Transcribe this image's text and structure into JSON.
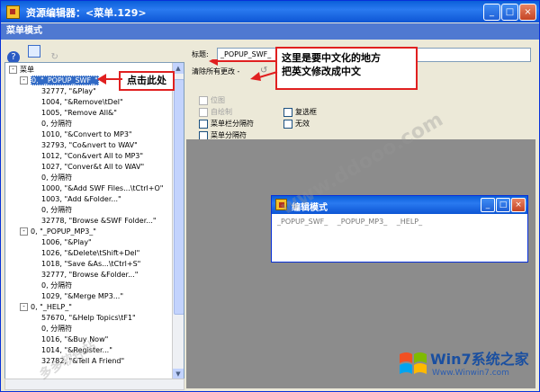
{
  "window": {
    "title": "资源编辑器：<菜单.129>",
    "min": "_",
    "max": "□",
    "close": "×"
  },
  "mode_bar": "菜单模式",
  "toolbar": {
    "help": "?",
    "image": "▣",
    "disabled": "↻"
  },
  "tree": {
    "root": "菜单",
    "rows": [
      {
        "text": "0, \"_POPUP_SWF_\"",
        "level": 1,
        "expand": "-",
        "selected": true
      },
      {
        "text": "32777, \"&Play\"",
        "level": 2
      },
      {
        "text": "1004, \"&Remove\\tDel\"",
        "level": 2
      },
      {
        "text": "1005, \"Remove All&\"",
        "level": 2
      },
      {
        "text": "0, 分隔符",
        "level": 2
      },
      {
        "text": "1010, \"&Convert to MP3\"",
        "level": 2
      },
      {
        "text": "32793, \"Co&nvert to WAV\"",
        "level": 2
      },
      {
        "text": "1012, \"Con&vert All to MP3\"",
        "level": 2
      },
      {
        "text": "1027, \"Conver&t All to WAV\"",
        "level": 2
      },
      {
        "text": "0, 分隔符",
        "level": 2
      },
      {
        "text": "1000, \"&Add SWF Files...\\tCtrl+O\"",
        "level": 2
      },
      {
        "text": "1003, \"Add &Folder...\"",
        "level": 2
      },
      {
        "text": "0, 分隔符",
        "level": 2
      },
      {
        "text": "32778, \"Browse &SWF Folder...\"",
        "level": 2
      },
      {
        "text": "0, \"_POPUP_MP3_\"",
        "level": 1,
        "expand": "-"
      },
      {
        "text": "1006, \"&Play\"",
        "level": 2
      },
      {
        "text": "1026, \"&Delete\\tShift+Del\"",
        "level": 2
      },
      {
        "text": "1018, \"Save &As...\\tCtrl+S\"",
        "level": 2
      },
      {
        "text": "32777, \"Browse &Folder...\"",
        "level": 2
      },
      {
        "text": "0, 分隔符",
        "level": 2
      },
      {
        "text": "1029, \"&Merge MP3...\"",
        "level": 2
      },
      {
        "text": "0, \"_HELP_\"",
        "level": 1,
        "expand": "-"
      },
      {
        "text": "57670, \"&Help Topics\\tF1\"",
        "level": 2
      },
      {
        "text": "0, 分隔符",
        "level": 2
      },
      {
        "text": "1016, \"&Buy Now\"",
        "level": 2
      },
      {
        "text": "1014, \"&Register...\"",
        "level": 2
      },
      {
        "text": "32782, \"&Tell A Friend\"",
        "level": 2
      }
    ]
  },
  "props": {
    "title_label": "标题:",
    "title_value": "_POPUP_SWF_",
    "clear_label": "清除所有更改 -",
    "checkboxes_left": [
      "位图",
      "自绘制",
      "菜单栏分隔符",
      "菜单分隔符"
    ],
    "checkboxes_right": [
      "复选框",
      "无效"
    ]
  },
  "annotations": {
    "click_here": "点击此处",
    "note_line1": "这里是要中文化的地方",
    "note_line2": "把英文修改成中文"
  },
  "edit_window": {
    "title": "编辑模式",
    "menu_items": [
      "_POPUP_SWF_",
      "_POPUP_MP3_",
      "_HELP_"
    ]
  },
  "watermark": {
    "text1": "www.ddooo.com",
    "text2": "多多软件站"
  },
  "logo": {
    "text": "Win7系统之家",
    "url": "Www.Winwin7.com"
  }
}
